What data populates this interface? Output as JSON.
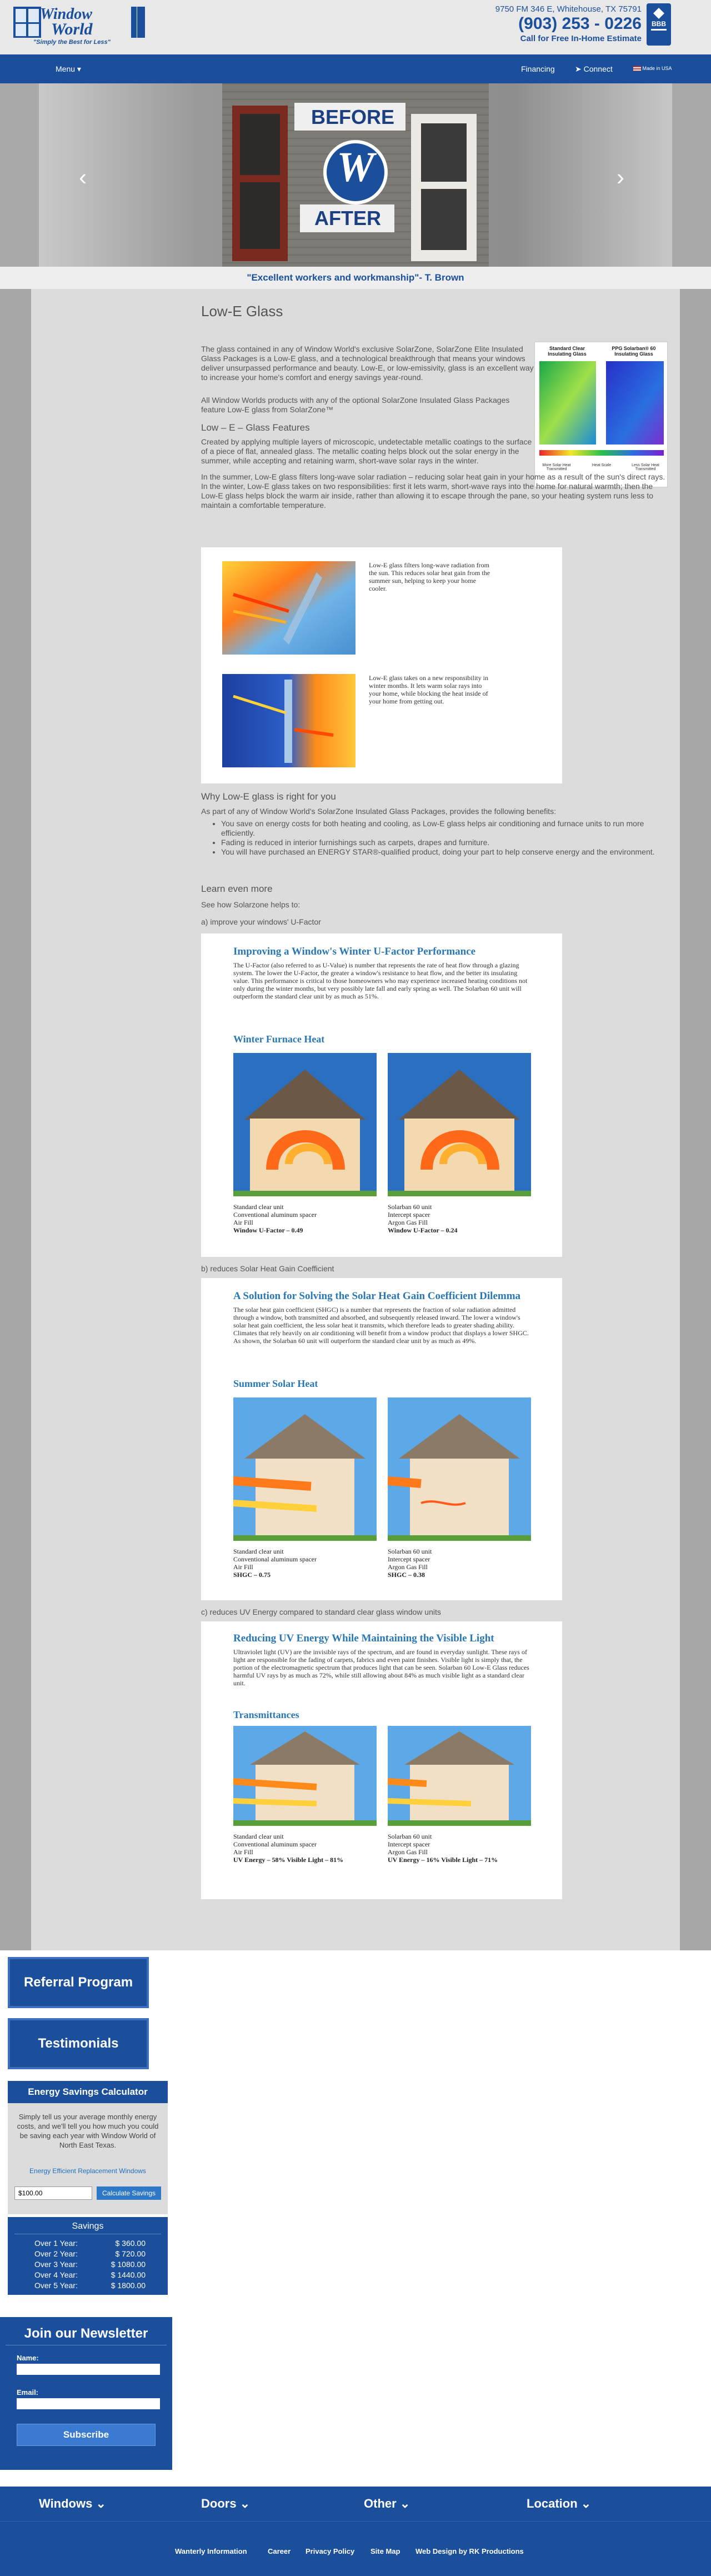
{
  "header": {
    "logo_line1": "Window",
    "logo_line2": "World",
    "logo_tagline": "\"Simply the Best for Less\"",
    "address": "9750 FM 346 E, Whitehouse, TX 75791",
    "phone": "(903) 253 - 0226",
    "cta": "Call for Free In-Home Estimate",
    "bbb_label": "BBB"
  },
  "nav": {
    "menu_label": "Menu",
    "financing_label": "Financing",
    "connect_label": "Connect",
    "flag_label": "Made in USA"
  },
  "slider": {
    "before_label": "BEFORE",
    "after_label": "AFTER",
    "logo_letter": "W"
  },
  "testimonial": "\"Excellent workers and workmanship\"- T. Brown",
  "content": {
    "title": "Low-E Glass",
    "intro_p1": "The glass contained in any of Window World's exclusive SolarZone, SolarZone Elite Insulated Glass Packages is a Low-E glass, and a technological breakthrough that means your windows deliver unsurpassed performance and beauty. Low-E, or low-emissivity, glass is an excellent way to increase your home's comfort and energy savings year-round.",
    "intro_p2": "All Window Worlds products with any of the optional SolarZone Insulated Glass Packages feature Low-E glass from SolarZone™",
    "section1_heading": "Low – E – Glass Features",
    "section1_p1": "Created by applying multiple layers of microscopic, undetectable metallic coatings to the surface of a piece of flat, annealed glass. The metallic coating helps block out the solar energy in the summer, while accepting and retaining warm, short-wave solar rays in the winter.",
    "section1_p2": "In the summer, Low-E glass filters long-wave solar radiation – reducing solar heat gain in your home as a result of the sun's direct rays. In the winter, Low-E glass takes on two responsibilities: first it lets warm, short-wave rays into the home for natural warmth; then the Low-E glass helps block the warm air inside, rather than allowing it to escape through the pane, so your heating system runs less to maintain a comfortable temperature.",
    "comparison_fig": {
      "col1": "Standard Clear Insulating Glass",
      "col2": "PPG Solarban® 60 Insulating Glass",
      "scale1": "More Solar Heat Transmitted",
      "scale2": "Heat Scale",
      "scale3": "Less Solar Heat Transmitted"
    },
    "lowe_panel": {
      "summer_text": "Low-E glass filters long-wave radiation from the sun. This reduces solar heat gain from the summer sun, helping to keep your home cooler.",
      "winter_text": "Low-E glass takes on a new responsibility in winter months. It lets warm solar rays into your home, while blocking the heat inside of your home from getting out."
    },
    "why_heading": "Why Low-E glass is right for you",
    "why_intro": "As part of any of Window World's SolarZone Insulated Glass Packages, provides the following benefits:",
    "benefits": [
      "You save on energy costs for both heating and cooling, as Low-E glass helps air conditioning and furnace units to run more efficiently.",
      "Fading is reduced in interior furnishings such as carpets, drapes and furniture.",
      "You will have purchased an ENERGY STAR®-qualified product, doing your part to help conserve energy and the environment."
    ],
    "learn_heading": "Learn even more",
    "learn_intro": "See how Solarzone helps to:",
    "item_a": "a) improve your windows' U-Factor",
    "item_b": "b) reduces Solar Heat Gain Coefficient",
    "item_c": "c) reduces UV Energy compared to standard clear glass window units"
  },
  "panel_a": {
    "title": "Improving a Window's Winter U-Factor Performance",
    "text": "The U-Factor (also referred to as U-Value) is  number that represents the rate of heat flow through a glazing system. The lower the U-Factor, the greater a window's resistance to heat flow, and the better its insulating value. This performance is critical to those homeowners who may experience increased heating conditions not only during the winter months, but very possibly late fall and early spring as well. The Solarban 60 unit will outperform the standard clear unit by as much as 51%.",
    "sub": "Winter Furnace Heat",
    "left_cap": [
      "Standard clear unit",
      "Conventional aluminum spacer",
      "Air Fill"
    ],
    "left_val": "Window U-Factor – 0.49",
    "right_cap": [
      "Solarban 60 unit",
      "Intercept spacer",
      "Argon Gas Fill"
    ],
    "right_val": "Window U-Factor – 0.24"
  },
  "panel_b": {
    "title": "A Solution for Solving the Solar Heat Gain Coefficient Dilemma",
    "text": "The solar heat gain coefficient (SHGC) is a number that represents the fraction of solar radiation admitted through a window, both transmitted and absorbed, and subsequently released inward. The lower a window's solar heat gain coefficient, the less solar heat it transmits, which therefore leads to greater shading ability. Climates that rely heavily on air conditioning will benefit from a window product that displays a lower SHGC. As shown, the Solarban 60 unit will outperform the standard clear unit by as much as 49%.",
    "sub": "Summer Solar Heat",
    "left_cap": [
      "Standard clear unit",
      "Conventional aluminum spacer",
      "Air Fill"
    ],
    "left_val": "SHGC – 0.75",
    "right_cap": [
      "Solarban 60 unit",
      "Intercept spacer",
      "Argon Gas Fill"
    ],
    "right_val": "SHGC – 0.38"
  },
  "panel_c": {
    "title": "Reducing UV Energy While Maintaining the Visible Light",
    "text": "Ultraviolet light (UV) are the invisible rays of the spectrum, and are found in everyday sunlight. These rays of light are responsible for the fading of carpets, fabrics and even paint finishes. Visible light is simply that, the portion of the electromagnetic spectrum that produces light that can be seen. Solarban 60 Low-E Glass reduces harmful UV rays by as much as 72%, while still allowing about 84% as much visible light as a standard clear unit.",
    "sub": "Transmittances",
    "left_cap": [
      "Standard clear unit",
      "Conventional aluminum spacer",
      "Air Fill"
    ],
    "left_val": "UV Energy – 58%   Visible Light – 81%",
    "right_cap": [
      "Solarban 60 unit",
      "Intercept spacer",
      "Argon Gas Fill"
    ],
    "right_val": "UV Energy – 16%   Visible Light – 71%"
  },
  "sidebar": {
    "referral_label": "Referral Program",
    "testimonials_label": "Testimonials",
    "calc_title": "Energy Savings Calculator",
    "calc_desc": "Simply tell us your average monthly energy costs, and we'll tell you how much you could be saving each year with Window World of North East Texas.",
    "calc_link": "Energy Efficient Replacement Windows",
    "calc_input": "$100.00",
    "calc_button": "Calculate Savings",
    "savings_title": "Savings",
    "savings": [
      {
        "label": "Over 1 Year:",
        "value": "$ 360.00"
      },
      {
        "label": "Over 2 Year:",
        "value": "$ 720.00"
      },
      {
        "label": "Over 3 Year:",
        "value": "$ 1080.00"
      },
      {
        "label": "Over 4 Year:",
        "value": "$ 1440.00"
      },
      {
        "label": "Over 5 Year:",
        "value": "$ 1800.00"
      }
    ],
    "newsletter_title": "Join our Newsletter",
    "name_label": "Name:",
    "email_label": "Email:",
    "subscribe_label": "Subscribe"
  },
  "footer": {
    "nav": [
      "Windows",
      "Doors",
      "Other",
      "Location"
    ],
    "links": [
      "Wanterly Information",
      "Career",
      "Privacy Policy",
      "Site Map",
      "Web Design by RK Productions"
    ]
  }
}
